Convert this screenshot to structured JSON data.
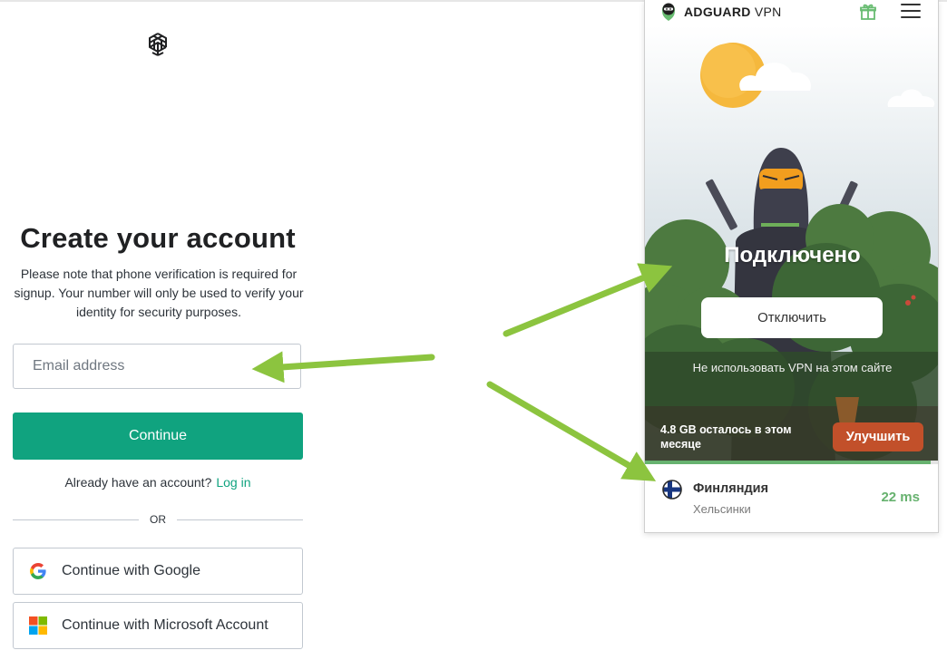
{
  "signup": {
    "title": "Create your account",
    "note": "Please note that phone verification is required for signup. Your number will only be used to verify your identity for security purposes.",
    "email_placeholder": "Email address",
    "continue_label": "Continue",
    "login_prompt": "Already have an account?",
    "login_link": "Log in",
    "divider_text": "OR",
    "google_label": "Continue with Google",
    "microsoft_label": "Continue with Microsoft Account",
    "accent_color": "#10a37f"
  },
  "vpn": {
    "brand_bold": "ADGUARD",
    "brand_light": "VPN",
    "status": "Подключено",
    "disconnect_label": "Отключить",
    "exclude_site": "Не использовать VPN на этом сайте",
    "traffic_text": "4.8 GB осталось в этом месяце",
    "upgrade_label": "Улучшить",
    "traffic_remaining_fraction": 0.97,
    "location": {
      "country": "Финляндия",
      "city": "Хельсинки",
      "ping": "22 ms"
    },
    "icons": [
      "adguard-logo-icon",
      "gift-icon",
      "menu-icon",
      "finland-flag-icon"
    ],
    "colors": {
      "upgrade": "#c2502a",
      "ping": "#67b26f"
    }
  },
  "annotation": {
    "arrow_color": "#8cc43f",
    "arrow_count": 3
  }
}
